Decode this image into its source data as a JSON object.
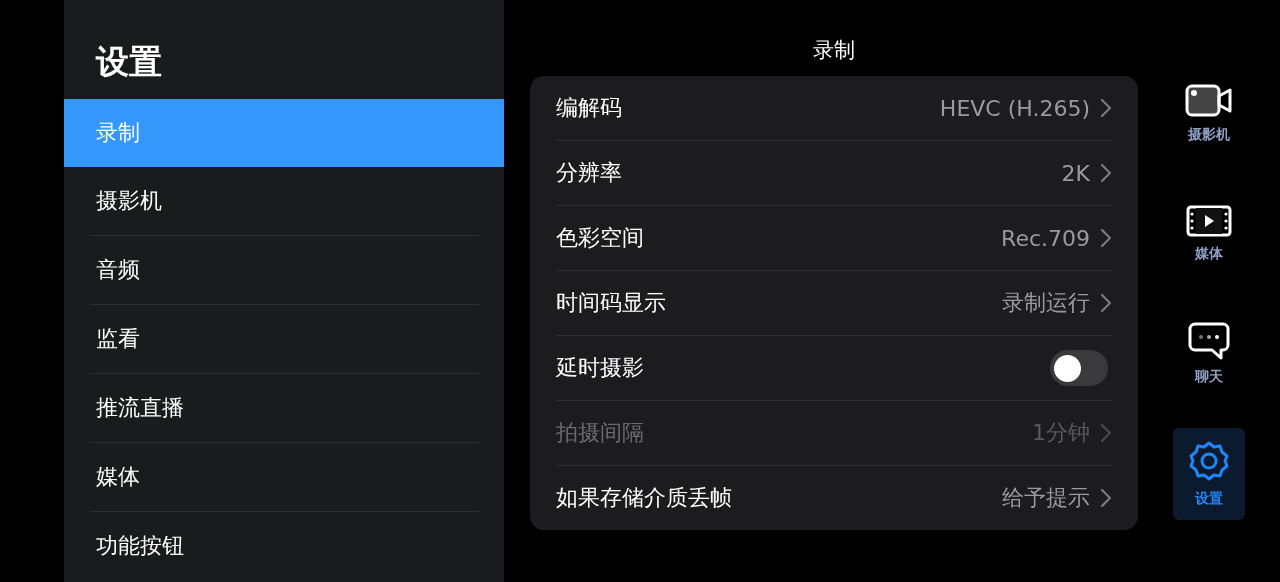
{
  "sidebar": {
    "title": "设置",
    "items": [
      {
        "label": "录制",
        "selected": true
      },
      {
        "label": "摄影机",
        "selected": false
      },
      {
        "label": "音频",
        "selected": false
      },
      {
        "label": "监看",
        "selected": false
      },
      {
        "label": "推流直播",
        "selected": false
      },
      {
        "label": "媒体",
        "selected": false
      },
      {
        "label": "功能按钮",
        "selected": false
      }
    ]
  },
  "main": {
    "title": "录制",
    "rows": [
      {
        "kind": "link",
        "label": "编解码",
        "value": "HEVC (H.265)",
        "disabled": false
      },
      {
        "kind": "link",
        "label": "分辨率",
        "value": "2K",
        "disabled": false
      },
      {
        "kind": "link",
        "label": "色彩空间",
        "value": "Rec.709",
        "disabled": false
      },
      {
        "kind": "link",
        "label": "时间码显示",
        "value": "录制运行",
        "disabled": false
      },
      {
        "kind": "toggle",
        "label": "延时摄影",
        "on": false,
        "disabled": false
      },
      {
        "kind": "link",
        "label": "拍摄间隔",
        "value": "1分钟",
        "disabled": true
      },
      {
        "kind": "link",
        "label": "如果存储介质丢帧",
        "value": "给予提示",
        "disabled": false
      }
    ]
  },
  "rail": [
    {
      "label": "摄影机",
      "selected": false
    },
    {
      "label": "媒体",
      "selected": false
    },
    {
      "label": "聊天",
      "selected": false
    },
    {
      "label": "设置",
      "selected": true
    }
  ]
}
